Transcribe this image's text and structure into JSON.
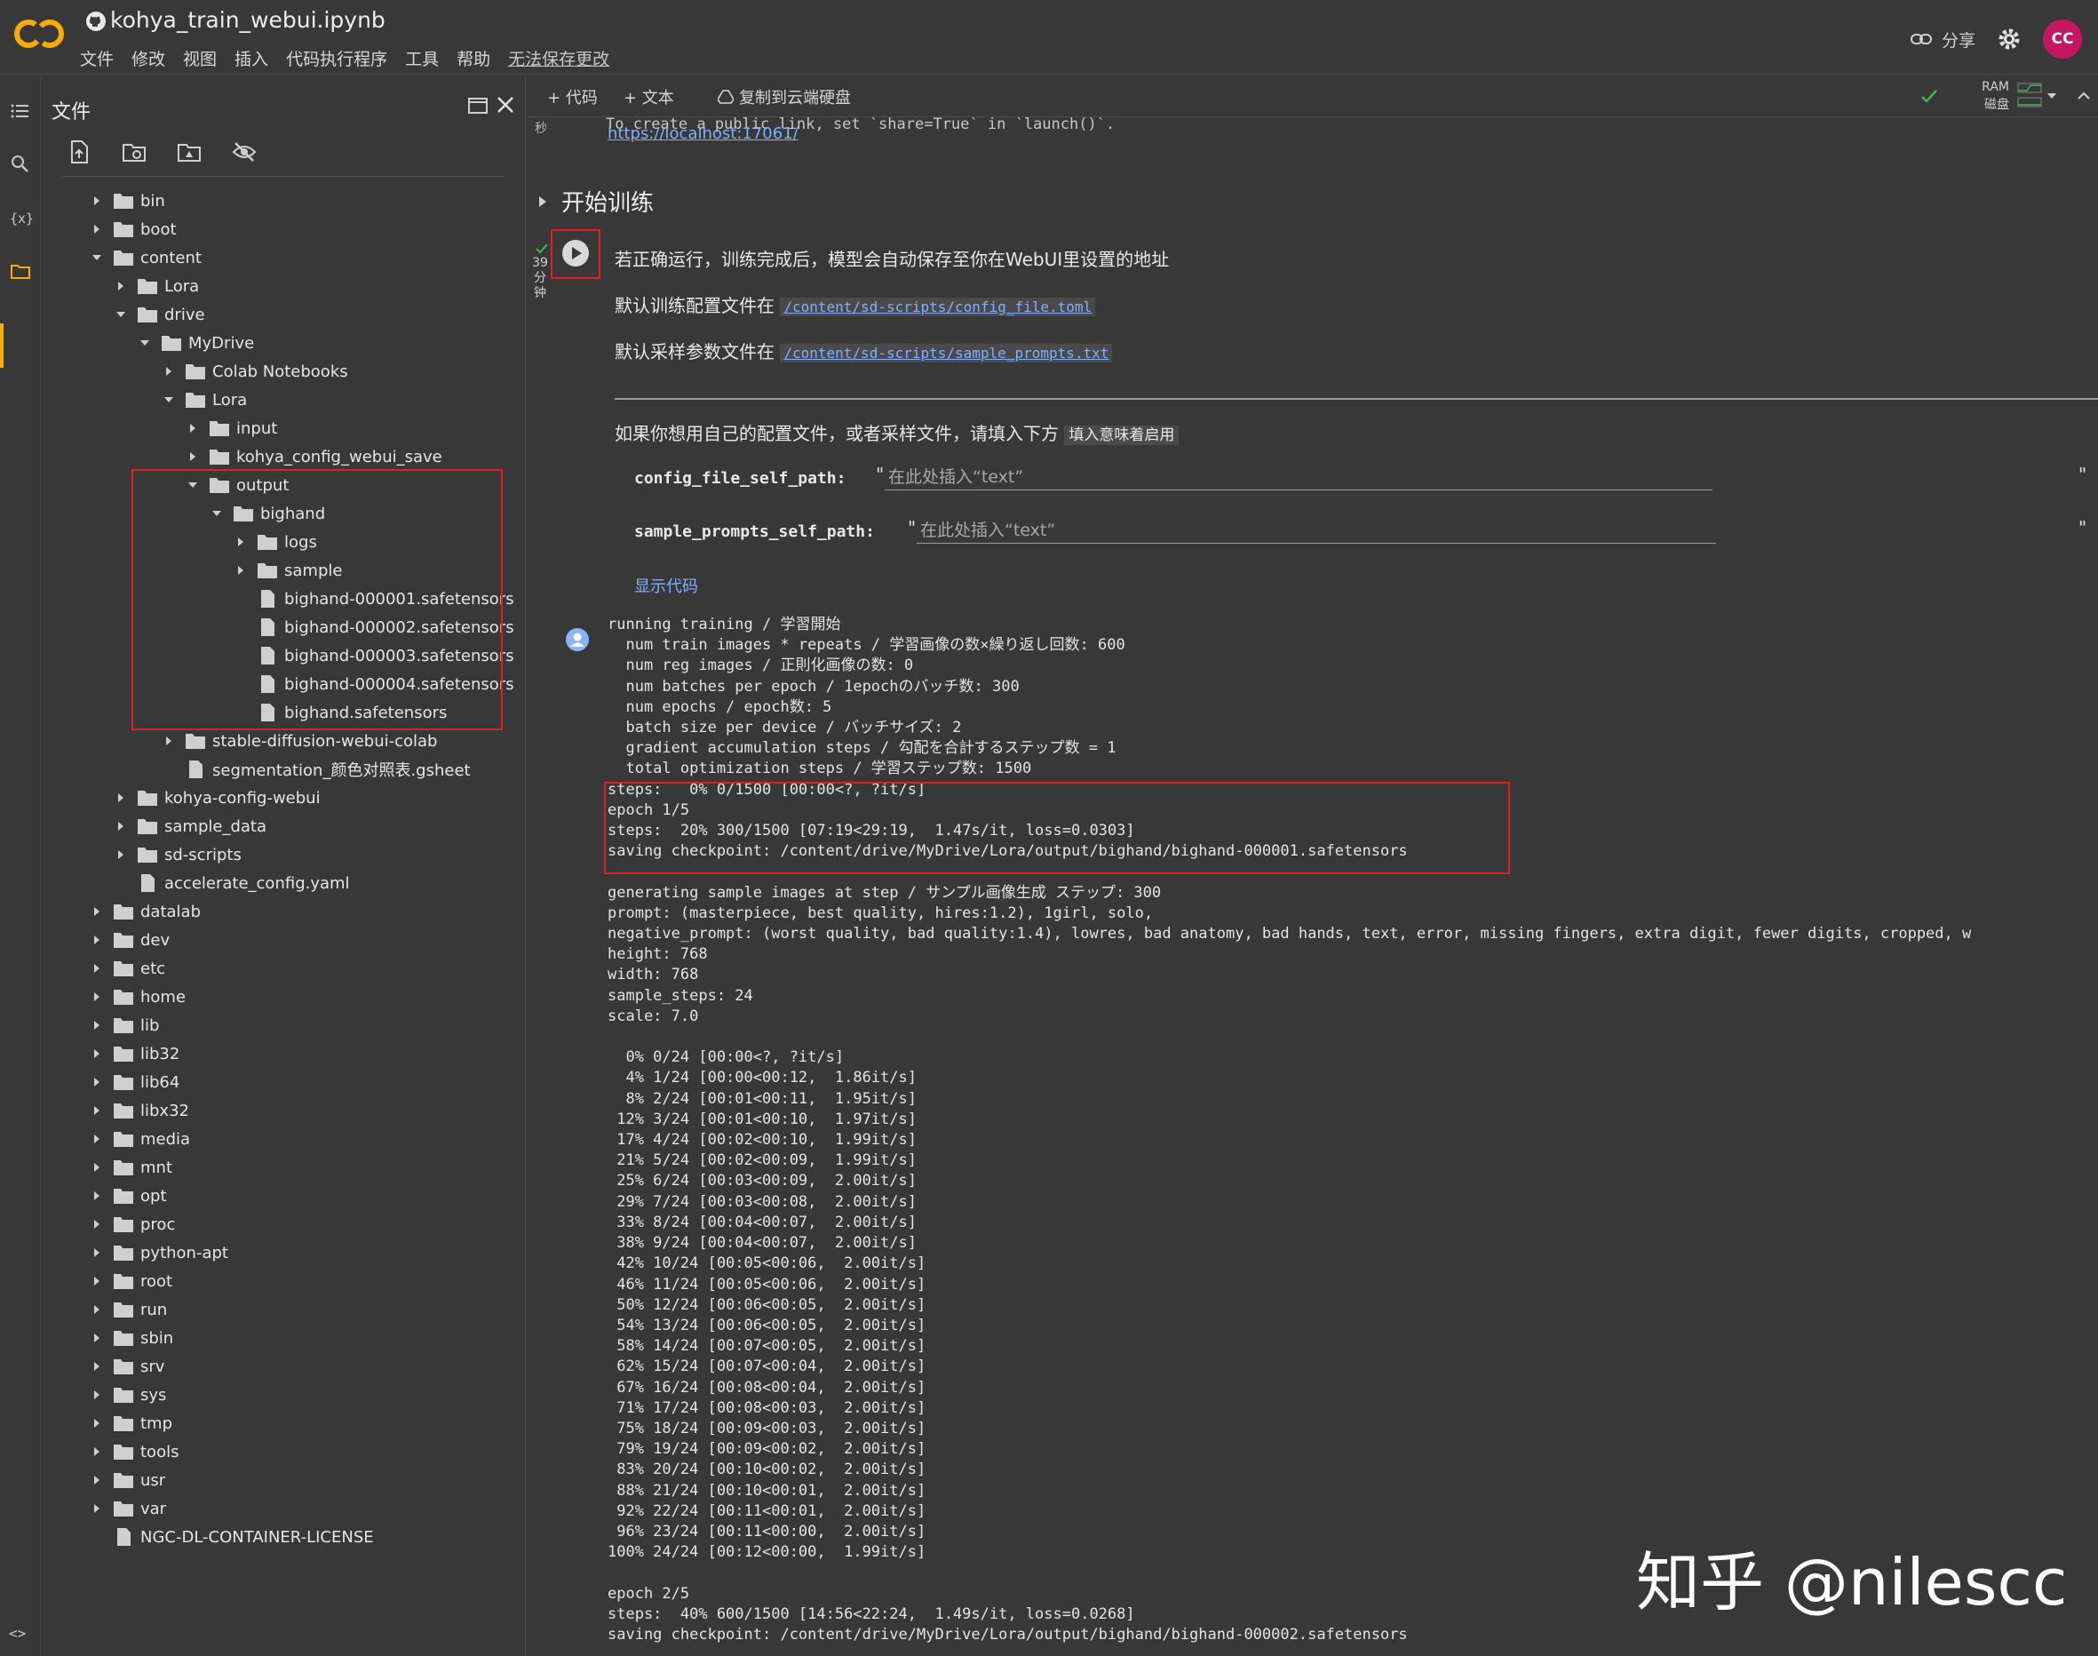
{
  "header": {
    "notebook_title": "kohya_train_webui.ipynb",
    "menu": [
      "文件",
      "修改",
      "视图",
      "插入",
      "代码执行程序",
      "工具",
      "帮助"
    ],
    "unsaved_label": "无法保存更改",
    "share_label": "分享",
    "avatar_initials": "CC"
  },
  "files_panel": {
    "title": "文件",
    "tree": [
      {
        "label": "bin",
        "depth": 0,
        "type": "folder",
        "state": "collapsed"
      },
      {
        "label": "boot",
        "depth": 0,
        "type": "folder",
        "state": "collapsed"
      },
      {
        "label": "content",
        "depth": 0,
        "type": "folder",
        "state": "expanded"
      },
      {
        "label": "Lora",
        "depth": 1,
        "type": "folder",
        "state": "collapsed"
      },
      {
        "label": "drive",
        "depth": 1,
        "type": "folder",
        "state": "expanded"
      },
      {
        "label": "MyDrive",
        "depth": 2,
        "type": "folder",
        "state": "expanded"
      },
      {
        "label": "Colab Notebooks",
        "depth": 3,
        "type": "folder",
        "state": "collapsed"
      },
      {
        "label": "Lora",
        "depth": 3,
        "type": "folder",
        "state": "expanded"
      },
      {
        "label": "input",
        "depth": 4,
        "type": "folder",
        "state": "collapsed"
      },
      {
        "label": "kohya_config_webui_save",
        "depth": 4,
        "type": "folder",
        "state": "collapsed"
      },
      {
        "label": "output",
        "depth": 4,
        "type": "folder",
        "state": "expanded"
      },
      {
        "label": "bighand",
        "depth": 5,
        "type": "folder",
        "state": "expanded"
      },
      {
        "label": "logs",
        "depth": 6,
        "type": "folder",
        "state": "collapsed"
      },
      {
        "label": "sample",
        "depth": 6,
        "type": "folder",
        "state": "collapsed"
      },
      {
        "label": "bighand-000001.safetensors",
        "depth": 6,
        "type": "file"
      },
      {
        "label": "bighand-000002.safetensors",
        "depth": 6,
        "type": "file"
      },
      {
        "label": "bighand-000003.safetensors",
        "depth": 6,
        "type": "file"
      },
      {
        "label": "bighand-000004.safetensors",
        "depth": 6,
        "type": "file"
      },
      {
        "label": "bighand.safetensors",
        "depth": 6,
        "type": "file"
      },
      {
        "label": "stable-diffusion-webui-colab",
        "depth": 3,
        "type": "folder",
        "state": "collapsed"
      },
      {
        "label": "segmentation_颜色对照表.gsheet",
        "depth": 3,
        "type": "file"
      },
      {
        "label": "kohya-config-webui",
        "depth": 1,
        "type": "folder",
        "state": "collapsed"
      },
      {
        "label": "sample_data",
        "depth": 1,
        "type": "folder",
        "state": "collapsed"
      },
      {
        "label": "sd-scripts",
        "depth": 1,
        "type": "folder",
        "state": "collapsed"
      },
      {
        "label": "accelerate_config.yaml",
        "depth": 1,
        "type": "file"
      },
      {
        "label": "datalab",
        "depth": 0,
        "type": "folder",
        "state": "collapsed"
      },
      {
        "label": "dev",
        "depth": 0,
        "type": "folder",
        "state": "collapsed"
      },
      {
        "label": "etc",
        "depth": 0,
        "type": "folder",
        "state": "collapsed"
      },
      {
        "label": "home",
        "depth": 0,
        "type": "folder",
        "state": "collapsed"
      },
      {
        "label": "lib",
        "depth": 0,
        "type": "folder",
        "state": "collapsed"
      },
      {
        "label": "lib32",
        "depth": 0,
        "type": "folder",
        "state": "collapsed"
      },
      {
        "label": "lib64",
        "depth": 0,
        "type": "folder",
        "state": "collapsed"
      },
      {
        "label": "libx32",
        "depth": 0,
        "type": "folder",
        "state": "collapsed"
      },
      {
        "label": "media",
        "depth": 0,
        "type": "folder",
        "state": "collapsed"
      },
      {
        "label": "mnt",
        "depth": 0,
        "type": "folder",
        "state": "collapsed"
      },
      {
        "label": "opt",
        "depth": 0,
        "type": "folder",
        "state": "collapsed"
      },
      {
        "label": "proc",
        "depth": 0,
        "type": "folder",
        "state": "collapsed"
      },
      {
        "label": "python-apt",
        "depth": 0,
        "type": "folder",
        "state": "collapsed"
      },
      {
        "label": "root",
        "depth": 0,
        "type": "folder",
        "state": "collapsed"
      },
      {
        "label": "run",
        "depth": 0,
        "type": "folder",
        "state": "collapsed"
      },
      {
        "label": "sbin",
        "depth": 0,
        "type": "folder",
        "state": "collapsed"
      },
      {
        "label": "srv",
        "depth": 0,
        "type": "folder",
        "state": "collapsed"
      },
      {
        "label": "sys",
        "depth": 0,
        "type": "folder",
        "state": "collapsed"
      },
      {
        "label": "tmp",
        "depth": 0,
        "type": "folder",
        "state": "collapsed"
      },
      {
        "label": "tools",
        "depth": 0,
        "type": "folder",
        "state": "collapsed"
      },
      {
        "label": "usr",
        "depth": 0,
        "type": "folder",
        "state": "collapsed"
      },
      {
        "label": "var",
        "depth": 0,
        "type": "folder",
        "state": "collapsed"
      },
      {
        "label": "NGC-DL-CONTAINER-LICENSE",
        "depth": 0,
        "type": "file"
      }
    ]
  },
  "toolbar": {
    "add_code": "+ 代码",
    "add_text": "+ 文本",
    "copy_drive": "复制到云端硬盘",
    "ram_label": "RAM",
    "disk_label": "磁盘"
  },
  "prev_cell": {
    "output_tail": "To create a public link, set `share=True` in `launch()`.",
    "link": "https://localhost:17061/",
    "time_unit": "秒"
  },
  "section_title": "开始训练",
  "cell": {
    "exec_minutes": "39",
    "exec_unit_1": "分",
    "exec_unit_2": "钟",
    "line1": "若正确运行，训练完成后，模型会自动保存至你在WebUI里设置的地址",
    "line2_prefix": "默认训练配置文件在",
    "line2_path": "/content/sd-scripts/config_file.toml",
    "line3_prefix": "默认采样参数文件在",
    "line3_path": "/content/sd-scripts/sample_prompts.txt",
    "line4_prefix": "如果你想用自己的配置文件，或者采样文件，请填入下方",
    "line4_pill": "填入意味着启用",
    "param1_name": "config_file_self_path:",
    "param1_placeholder": "在此处插入“text”",
    "param2_name": "sample_prompts_self_path:",
    "param2_placeholder": "在此处插入“text”",
    "show_code": "显示代码"
  },
  "output": {
    "block_intro": "running training / 学習開始\n  num train images * repeats / 学習画像の数×繰り返し回数: 600\n  num reg images / 正則化画像の数: 0\n  num batches per epoch / 1epochのバッチ数: 300\n  num epochs / epoch数: 5\n  batch size per device / バッチサイズ: 2\n  gradient accumulation steps / 勾配を合計するステップ数 = 1\n  total optimization steps / 学習ステップ数: 1500",
    "block_steps": "steps:   0% 0/1500 [00:00<?, ?it/s]\nepoch 1/5\nsteps:  20% 300/1500 [07:19<29:19,  1.47s/it, loss=0.0303]\nsaving checkpoint: /content/drive/MyDrive/Lora/output/bighand/bighand-000001.safetensors",
    "block_sample": "\ngenerating sample images at step / サンプル画像生成 ステップ: 300\nprompt: (masterpiece, best quality, hires:1.2), 1girl, solo,\nnegative_prompt: (worst quality, bad quality:1.4), lowres, bad anatomy, bad hands, text, error, missing fingers, extra digit, fewer digits, cropped, w\nheight: 768\nwidth: 768\nsample_steps: 24\nscale: 7.0\n\n  0% 0/24 [00:00<?, ?it/s]\n  4% 1/24 [00:00<00:12,  1.86it/s]\n  8% 2/24 [00:01<00:11,  1.95it/s]\n 12% 3/24 [00:01<00:10,  1.97it/s]\n 17% 4/24 [00:02<00:10,  1.99it/s]\n 21% 5/24 [00:02<00:09,  1.99it/s]\n 25% 6/24 [00:03<00:09,  2.00it/s]\n 29% 7/24 [00:03<00:08,  2.00it/s]\n 33% 8/24 [00:04<00:07,  2.00it/s]\n 38% 9/24 [00:04<00:07,  2.00it/s]\n 42% 10/24 [00:05<00:06,  2.00it/s]\n 46% 11/24 [00:05<00:06,  2.00it/s]\n 50% 12/24 [00:06<00:05,  2.00it/s]\n 54% 13/24 [00:06<00:05,  2.00it/s]\n 58% 14/24 [00:07<00:05,  2.00it/s]\n 62% 15/24 [00:07<00:04,  2.00it/s]\n 67% 16/24 [00:08<00:04,  2.00it/s]\n 71% 17/24 [00:08<00:03,  2.00it/s]\n 75% 18/24 [00:09<00:03,  2.00it/s]\n 79% 19/24 [00:09<00:02,  2.00it/s]\n 83% 20/24 [00:10<00:02,  2.00it/s]\n 88% 21/24 [00:10<00:01,  2.00it/s]\n 92% 22/24 [00:11<00:01,  2.00it/s]\n 96% 23/24 [00:11<00:00,  2.00it/s]\n100% 24/24 [00:12<00:00,  1.99it/s]\n\nepoch 2/5\nsteps:  40% 600/1500 [14:56<22:24,  1.49s/it, loss=0.0268]\nsaving checkpoint: /content/drive/MyDrive/Lora/output/bighand/bighand-000002.safetensors"
  },
  "watermark": "知乎 @nilescc",
  "colors": {
    "highlight": "#e02020",
    "accent": "#f9ab00",
    "link": "#7fb0ff",
    "avatar": "#c4175f"
  }
}
